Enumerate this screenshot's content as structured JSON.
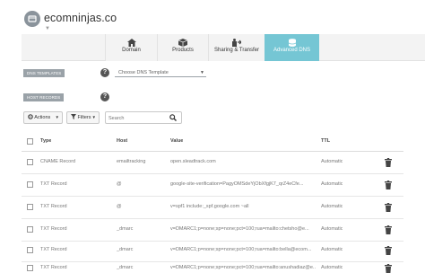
{
  "header": {
    "site_name": "ecomninjas.co"
  },
  "tabs": [
    {
      "label": "Domain",
      "icon": "house-icon"
    },
    {
      "label": "Products",
      "icon": "box-icon"
    },
    {
      "label": "Sharing & Transfer",
      "icon": "share-icon"
    },
    {
      "label": "Advanced DNS",
      "icon": "database-icon",
      "active": true
    }
  ],
  "dns_templates": {
    "title": "DNS TEMPLATES",
    "select_value": "Choose DNS Template"
  },
  "host_records": {
    "title": "HOST RECORDS"
  },
  "toolbar": {
    "actions_label": "Actions",
    "filters_label": "Filters",
    "search_placeholder": "Search"
  },
  "table": {
    "headers": {
      "type": "Type",
      "host": "Host",
      "value": "Value",
      "ttl": "TTL"
    },
    "rows": [
      {
        "type": "CNAME Record",
        "host": "emailtracking",
        "value": "open.sleadtrack.com",
        "ttl": "Automatic"
      },
      {
        "type": "TXT Record",
        "host": "@",
        "value": "google-site-verification=PagyOMSdeYjObXfgjK7_qrZ4eCfe...",
        "ttl": "Automatic"
      },
      {
        "type": "TXT Record",
        "host": "@",
        "value": "v=spf1 include:_spf.google.com ~all",
        "ttl": "Automatic"
      },
      {
        "type": "TXT Record",
        "host": "_dmarc",
        "value": "v=DMARC1;p=none;sp=none;pct=100;rua=mailto:chetsho@e...",
        "ttl": "Automatic"
      },
      {
        "type": "TXT Record",
        "host": "_dmarc",
        "value": "v=DMARC1;p=none;sp=none;pct=100;rua=mailto:bella@ecom...",
        "ttl": "Automatic"
      },
      {
        "type": "TXT Record",
        "host": "_dmarc",
        "value": "v=DMARC1;p=none;sp=none;pct=100;rua=mailto:anushadiaz@e...",
        "ttl": "Automatic"
      }
    ]
  },
  "colors": {
    "accent": "#75c6d4",
    "pill": "#9aa2a8"
  }
}
